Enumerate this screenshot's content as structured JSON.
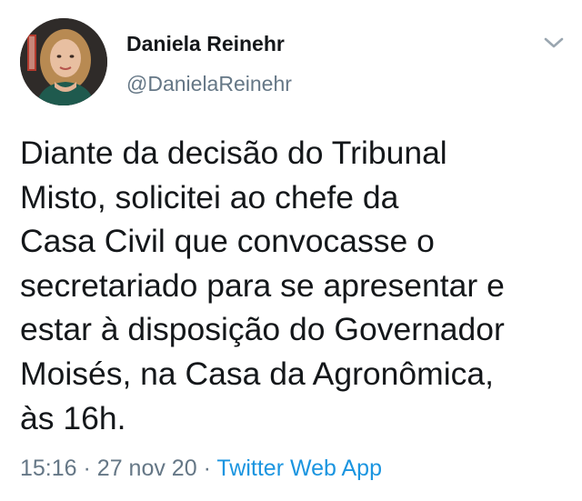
{
  "author": {
    "display_name": "Daniela Reinehr",
    "handle": "@DanielaReinehr"
  },
  "icons": {
    "caret": "chevron-down-icon"
  },
  "tweet": {
    "lines": [
      "Diante da decisão do Tribunal",
      "Misto, solicitei ao chefe da",
      "Casa Civil que convocasse o",
      "secretariado para se apresentar e",
      "estar à disposição do Governador",
      "Moisés, na Casa da Agronômica,",
      "às 16h."
    ]
  },
  "meta": {
    "time": "15:16",
    "separator": "·",
    "date": "27 nov 20",
    "source": "Twitter Web App"
  },
  "colors": {
    "text": "#14171a",
    "secondary": "#657786",
    "link": "#1b95e0"
  }
}
